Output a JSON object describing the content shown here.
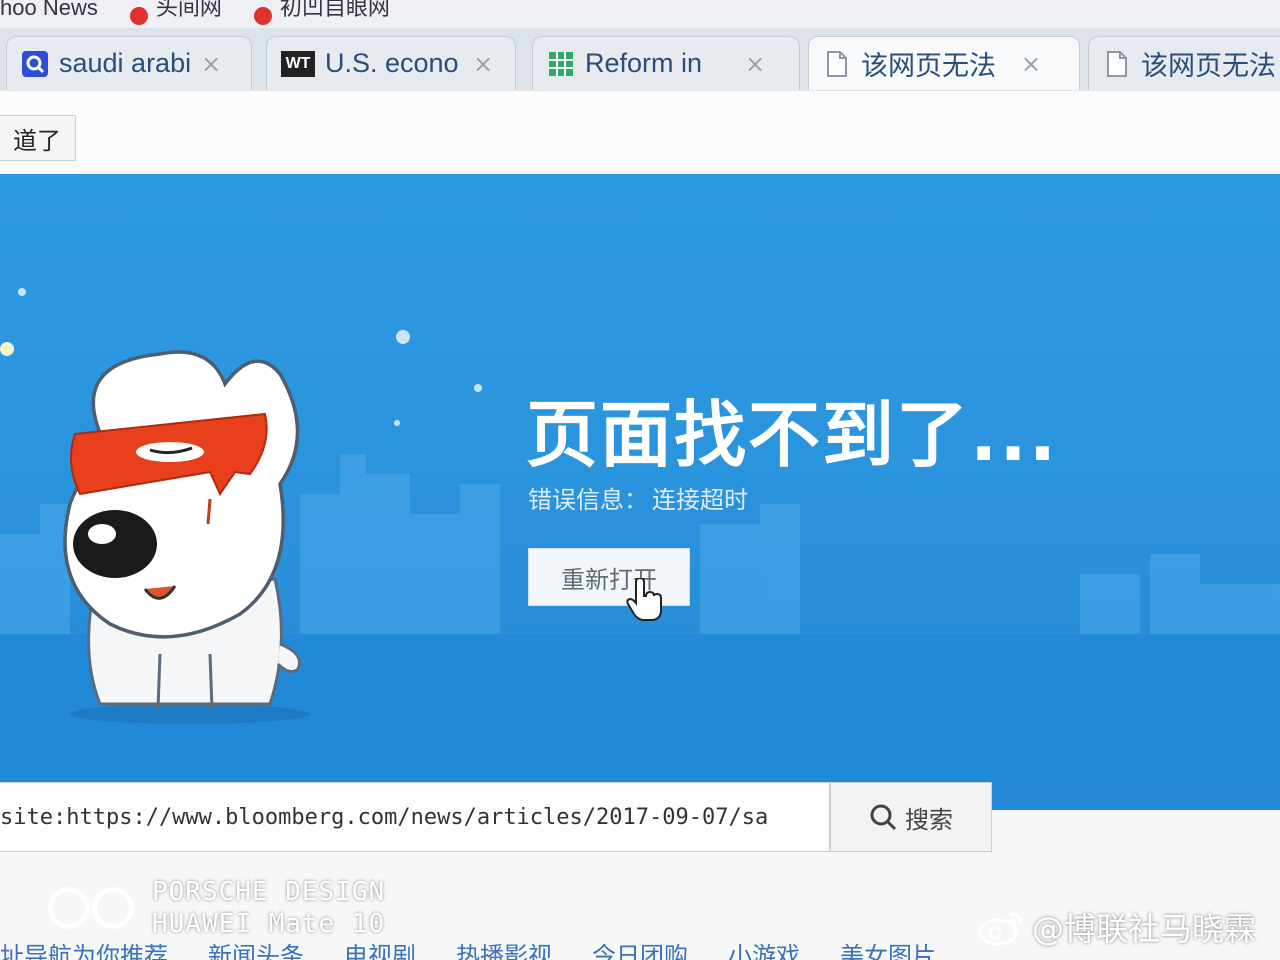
{
  "bookmarks_bar": {
    "items": [
      {
        "label": "hoo News"
      },
      {
        "label": "头间网"
      },
      {
        "label": "初凹自眼网"
      }
    ]
  },
  "tabs": [
    {
      "label": "saudi arabi",
      "icon": "search-icon",
      "close": "×"
    },
    {
      "label": "U.S. econo",
      "icon": "wt-icon",
      "icon_text": "WT",
      "close": "×"
    },
    {
      "label": "Reform in",
      "icon": "grid-icon",
      "close": "×"
    },
    {
      "label": "该网页无法",
      "icon": "page-icon",
      "close": "×",
      "active": true
    },
    {
      "label": "该网页无法",
      "icon": "page-icon",
      "close": "×"
    }
  ],
  "toolbar": {
    "notice_button": "道了"
  },
  "error_page": {
    "title": "页面找不到了...",
    "info_label": "错误信息：",
    "info_detail": "连接超时",
    "reopen_button": "重新打开"
  },
  "search": {
    "value": "site:https://www.bloomberg.com/news/articles/2017-09-07/sa",
    "button_label": "搜索"
  },
  "watermarks": {
    "camera_line1": "PORSCHE DESIGN",
    "camera_line2": "HUAWEI Mate 10",
    "weibo_user": "@博联社马晓霖"
  },
  "bottom_links": [
    "址导航为你推荐",
    "新闻头条",
    "电视剧",
    "热播影视",
    "今日团购",
    "小游戏",
    "美女图片"
  ],
  "colors": {
    "panel_blue": "#2a92dc",
    "title_white": "#ffffff",
    "mask_red": "#e8401d",
    "tab_text": "#2a4d7a"
  }
}
